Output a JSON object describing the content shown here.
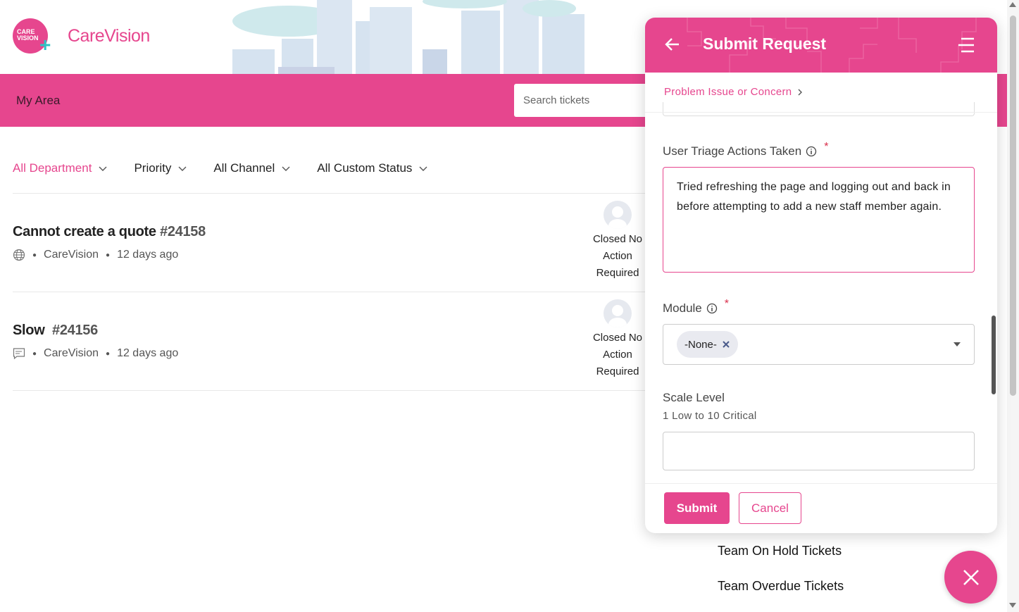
{
  "header": {
    "logo_text_line1": "CARE",
    "logo_text_line2": "VISION",
    "brand": "CareVision",
    "colors": {
      "brand_pink": "#e6468e",
      "accent_teal": "#2ec4c4"
    }
  },
  "navbar": {
    "title": "My Area",
    "search_placeholder": "Search tickets"
  },
  "filters": [
    {
      "label": "All Department",
      "active": true
    },
    {
      "label": "Priority",
      "active": false
    },
    {
      "label": "All Channel",
      "active": false
    },
    {
      "label": "All Custom Status",
      "active": false
    }
  ],
  "tickets": [
    {
      "title": "Cannot create a quote",
      "number": "#24158",
      "channel_icon": "globe-icon",
      "source": "CareVision",
      "age": "12 days ago",
      "status_line1": "Closed No",
      "status_line2": "Action",
      "status_line3": "Required"
    },
    {
      "title": "Slow",
      "number": "#24156",
      "channel_icon": "chat-icon",
      "source": "CareVision",
      "age": "12 days ago",
      "status_line1": "Closed No",
      "status_line2": "Action",
      "status_line3": "Required"
    }
  ],
  "background_menu": [
    "Team On Hold Tickets",
    "Team Overdue Tickets"
  ],
  "panel": {
    "title": "Submit Request",
    "breadcrumb": "Problem Issue or Concern",
    "triage": {
      "label": "User Triage Actions Taken",
      "required_mark": "*",
      "value": "Tried refreshing the page and logging out and back in before attempting to add a new staff member again."
    },
    "module": {
      "label": "Module",
      "required_mark": "*",
      "selected_chip": "-None-"
    },
    "scale": {
      "label": "Scale Level",
      "hint": "1 Low to 10 Critical",
      "value": ""
    },
    "submit_label": "Submit",
    "cancel_label": "Cancel"
  }
}
